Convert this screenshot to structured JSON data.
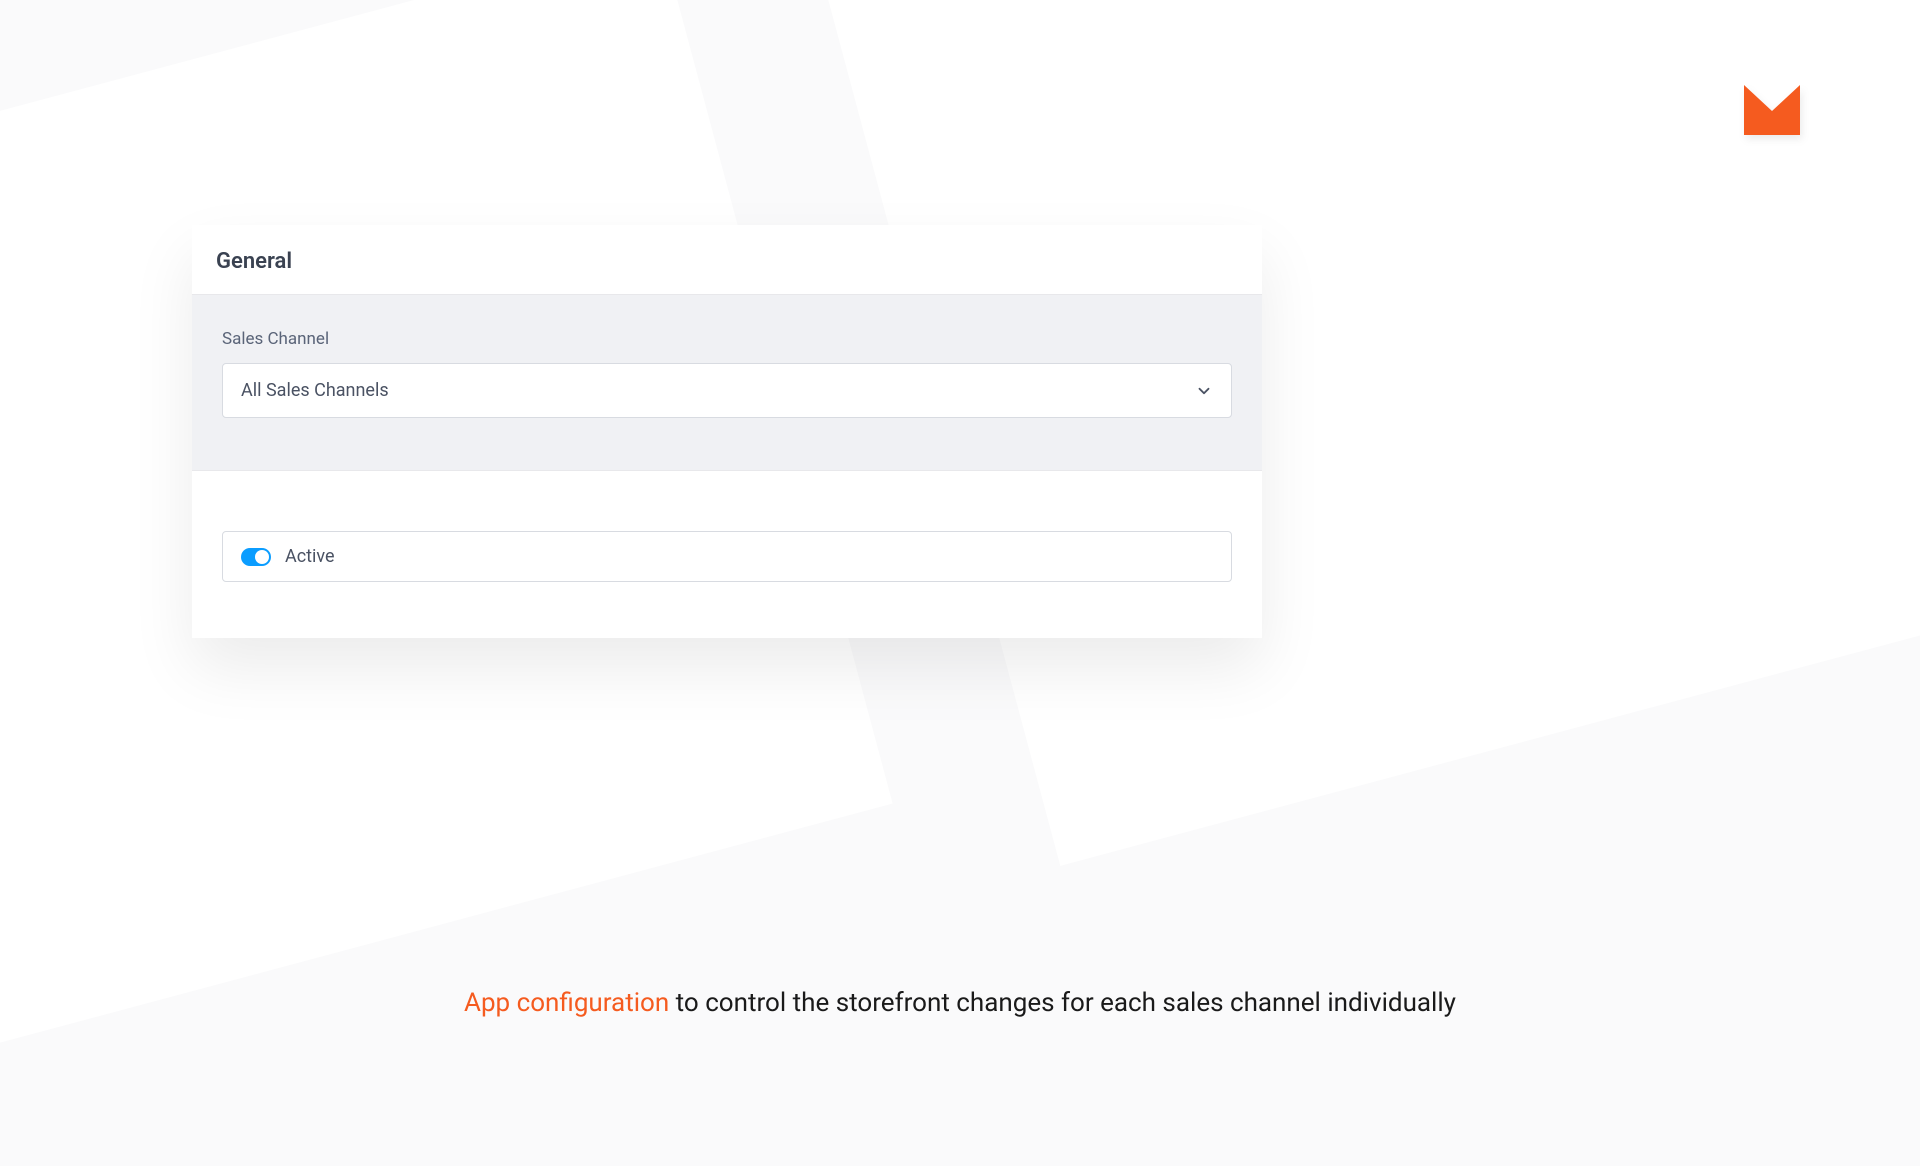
{
  "card": {
    "title": "General",
    "salesChannel": {
      "label": "Sales Channel",
      "selected": "All Sales Channels"
    },
    "active": {
      "label": "Active",
      "enabled": true
    }
  },
  "caption": {
    "highlight": "App configuration",
    "rest": " to control the storefront changes for each sales channel individually"
  },
  "colors": {
    "accent": "#f55b1f",
    "toggleOn": "#0b9dff"
  }
}
